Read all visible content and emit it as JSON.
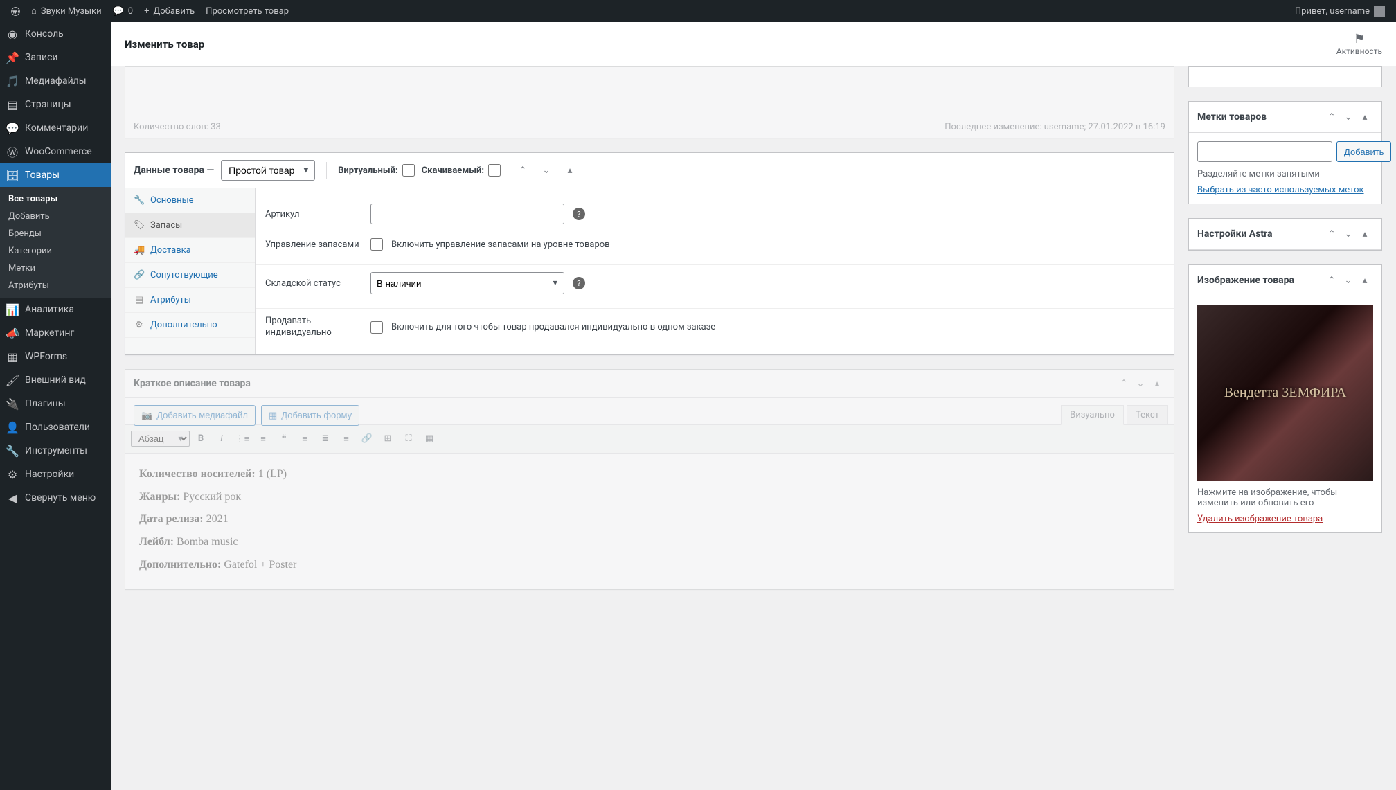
{
  "adminbar": {
    "site_name": "Звуки Музыки",
    "comments": "0",
    "add_new": "Добавить",
    "view_product": "Просмотреть товар",
    "greeting": "Привет, username"
  },
  "menu": {
    "dashboard": "Консоль",
    "posts": "Записи",
    "media": "Медиафайлы",
    "pages": "Страницы",
    "comments": "Комментарии",
    "woocommerce": "WooCommerce",
    "products": "Товары",
    "sub_all": "Все товары",
    "sub_add": "Добавить",
    "sub_brands": "Бренды",
    "sub_cats": "Категории",
    "sub_tags": "Метки",
    "sub_attrs": "Атрибуты",
    "analytics": "Аналитика",
    "marketing": "Маркетинг",
    "wpforms": "WPForms",
    "appearance": "Внешний вид",
    "plugins": "Плагины",
    "users": "Пользователи",
    "tools": "Инструменты",
    "settings": "Настройки",
    "collapse": "Свернуть меню"
  },
  "header": {
    "title": "Изменить товар",
    "activity": "Активность"
  },
  "editor_status": {
    "word_count": "Количество слов: 33",
    "last_edit": "Последнее изменение: username; 27.01.2022 в 16:19"
  },
  "product_data": {
    "title": "Данные товара —",
    "type": "Простой товар",
    "virtual_label": "Виртуальный:",
    "downloadable_label": "Скачиваемый:",
    "tabs": {
      "general": "Основные",
      "inventory": "Запасы",
      "shipping": "Доставка",
      "linked": "Сопутствующие",
      "attributes": "Атрибуты",
      "advanced": "Дополнительно"
    },
    "fields": {
      "sku_label": "Артикул",
      "sku_value": "",
      "manage_stock_label": "Управление запасами",
      "manage_stock_desc": "Включить управление запасами на уровне товаров",
      "stock_status_label": "Складской статус",
      "stock_status_value": "В наличии",
      "sold_individually_label": "Продавать индивидуально",
      "sold_individually_desc": "Включить для того чтобы товар продавался индивидуально в одном заказе"
    }
  },
  "short_desc": {
    "title": "Краткое описание товара",
    "add_media": "Добавить медиафайл",
    "add_form": "Добавить форму",
    "tab_visual": "Визуально",
    "tab_text": "Текст",
    "format": "Абзац",
    "content": {
      "line1_label": "Количество носителей:",
      "line1_value": " 1 (LP)",
      "line2_label": "Жанры:",
      "line2_value": " Русский рок",
      "line3_label": "Дата релиза:",
      "line3_value": " 2021",
      "line4_label": "Лейбл:",
      "line4_value": " Bomba music",
      "line5_label": "Дополнительно:",
      "line5_value": " Gatefol + Poster"
    }
  },
  "tags_box": {
    "title": "Метки товаров",
    "add_btn": "Добавить",
    "hint": "Разделяйте метки запятыми",
    "choose_link": "Выбрать из часто используемых меток"
  },
  "astra_box": {
    "title": "Настройки Astra"
  },
  "image_box": {
    "title": "Изображение товара",
    "hint": "Нажмите на изображение, чтобы изменить или обновить его",
    "remove_link": "Удалить изображение товара",
    "image_text": "Вендетта ЗЕМФИРА"
  }
}
